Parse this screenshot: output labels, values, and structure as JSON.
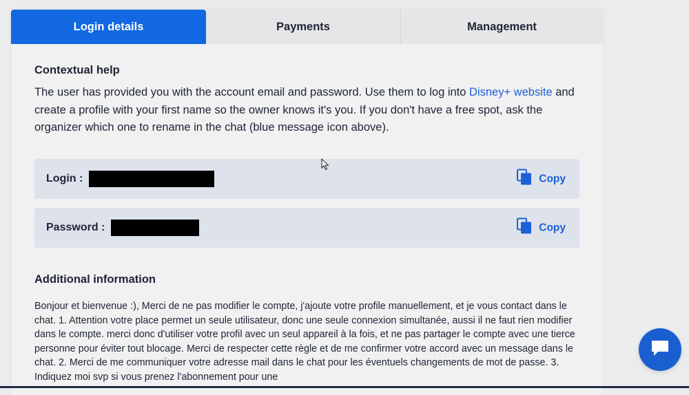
{
  "tabs": [
    {
      "label": "Login details",
      "active": true
    },
    {
      "label": "Payments",
      "active": false
    },
    {
      "label": "Management",
      "active": false
    }
  ],
  "contextual_help": {
    "title": "Contextual help",
    "text_before": "The user has provided you with the account email and password. Use them to log into ",
    "link_text": "Disney+ website",
    "text_after": " and create a profile with your first name so the owner knows it's you. If you don't have a free spot, ask the organizer which one to rename in the chat (blue message icon above)."
  },
  "credentials": {
    "login_label": "Login : ",
    "password_label": "Password : ",
    "copy_label": "Copy"
  },
  "additional_info": {
    "title": "Additional information",
    "text": "Bonjour et bienvenue :), Merci de ne pas modifier le compte, j'ajoute votre profile manuellement, et je vous contact dans le chat. 1. Attention votre place permet un seule utilisateur, donc une seule connexion simultanée, aussi il ne faut rien modifier dans le compte. merci donc d'utiliser votre profil avec un seul appareil à la fois, et ne pas partager le compte avec une tierce personne pour éviter tout blocage. Merci de respecter cette règle et de me confirmer votre accord avec un message dans le chat. 2. Merci de me communiquer votre adresse mail dans le chat pour les éventuels changements de mot de passe. 3. Indiquez moi svp si vous prenez l'abonnement pour une"
  },
  "colors": {
    "accent": "#1168e1",
    "link": "#1d5fd6",
    "row_bg": "#dde2eb",
    "chat_button": "#1a5fd0"
  },
  "icons": {
    "copy": "copy-icon",
    "chat": "chat-bubble-icon",
    "cursor": "mouse-cursor-icon"
  }
}
